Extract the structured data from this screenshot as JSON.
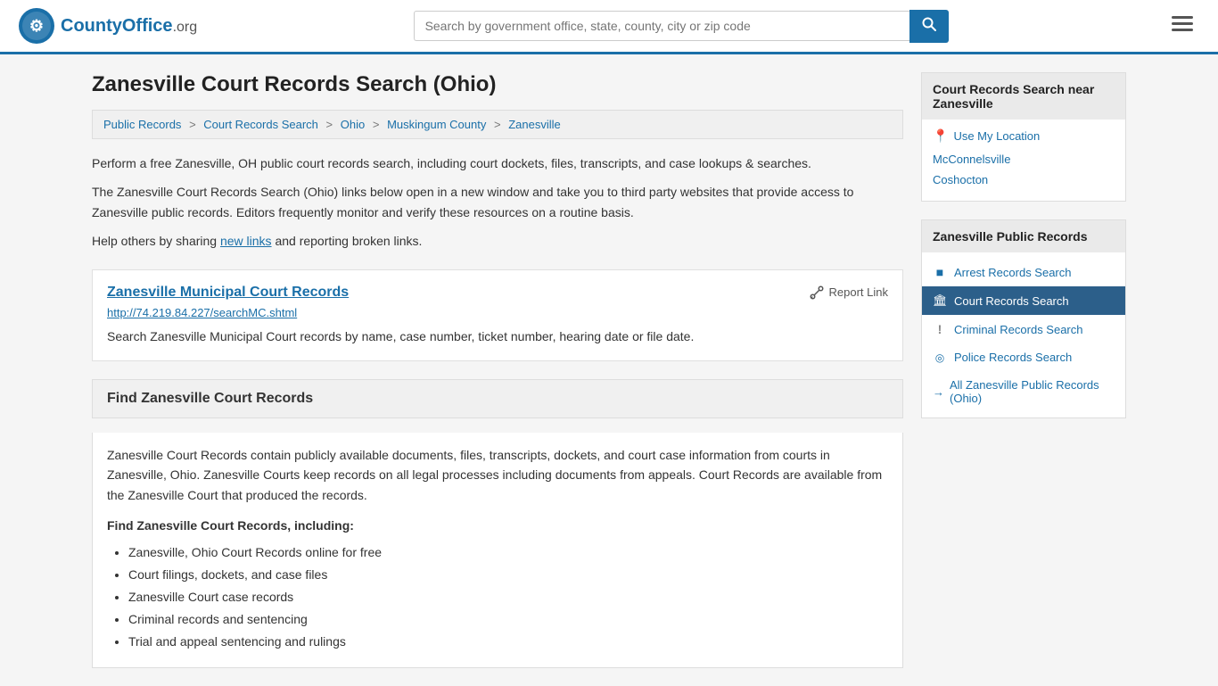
{
  "header": {
    "logo_text": "CountyOffice",
    "logo_suffix": ".org",
    "search_placeholder": "Search by government office, state, county, city or zip code",
    "search_value": ""
  },
  "page": {
    "title": "Zanesville Court Records Search (Ohio)"
  },
  "breadcrumb": {
    "items": [
      {
        "label": "Public Records",
        "href": "#"
      },
      {
        "label": "Court Records Search",
        "href": "#"
      },
      {
        "label": "Ohio",
        "href": "#"
      },
      {
        "label": "Muskingum County",
        "href": "#"
      },
      {
        "label": "Zanesville",
        "href": "#"
      }
    ]
  },
  "intro": {
    "text1": "Perform a free Zanesville, OH public court records search, including court dockets, files, transcripts, and case lookups & searches.",
    "text2": "The Zanesville Court Records Search (Ohio) links below open in a new window and take you to third party websites that provide access to Zanesville public records. Editors frequently monitor and verify these resources on a routine basis.",
    "help_text": "Help others by sharing ",
    "new_links_label": "new links",
    "help_text2": " and reporting broken links."
  },
  "record": {
    "title": "Zanesville Municipal Court Records",
    "url": "http://74.219.84.227/searchMC.shtml",
    "description": "Search Zanesville Municipal Court records by name, case number, ticket number, hearing date or file date.",
    "report_label": "Report Link"
  },
  "find_section": {
    "title": "Find Zanesville Court Records",
    "body_text": "Zanesville Court Records contain publicly available documents, files, transcripts, dockets, and court case information from courts in Zanesville, Ohio. Zanesville Courts keep records on all legal processes including documents from appeals. Court Records are available from the Zanesville Court that produced the records.",
    "sub_title": "Find Zanesville Court Records, including:",
    "list_items": [
      "Zanesville, Ohio Court Records online for free",
      "Court filings, dockets, and case files",
      "Zanesville Court case records",
      "Criminal records and sentencing",
      "Trial and appeal sentencing and rulings"
    ]
  },
  "sidebar": {
    "near_title": "Court Records Search near Zanesville",
    "use_location_label": "Use My Location",
    "nearby": [
      {
        "label": "McConnelsville",
        "href": "#"
      },
      {
        "label": "Coshocton",
        "href": "#"
      }
    ],
    "public_title": "Zanesville Public Records",
    "public_items": [
      {
        "label": "Arrest Records Search",
        "icon": "■",
        "active": false
      },
      {
        "label": "Court Records Search",
        "icon": "🏛",
        "active": true
      },
      {
        "label": "Criminal Records Search",
        "icon": "!",
        "active": false
      },
      {
        "label": "Police Records Search",
        "icon": "◎",
        "active": false
      }
    ],
    "all_link_label": "All Zanesville Public Records (Ohio)"
  }
}
